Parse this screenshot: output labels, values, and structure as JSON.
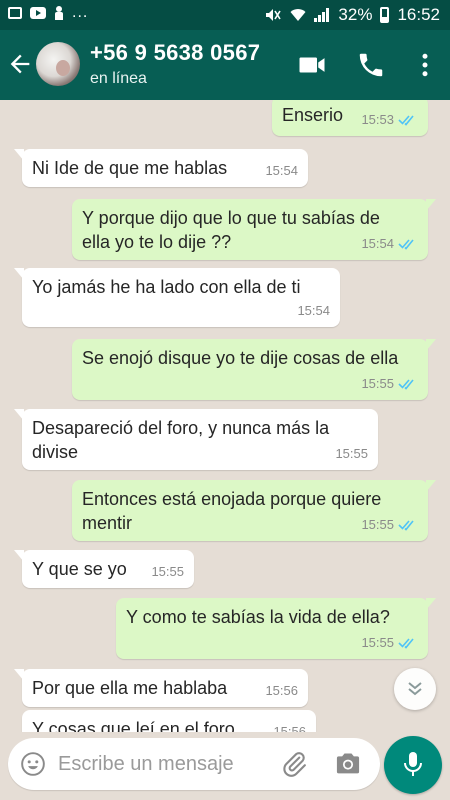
{
  "status_bar": {
    "more": "...",
    "battery": "32%",
    "time": "16:52"
  },
  "header": {
    "contact_name": "+56 9 5638 0567",
    "contact_status": "en línea",
    "colors": {
      "bar": "#075e54",
      "status_bar": "#054d44"
    }
  },
  "messages": [
    {
      "direction": "out",
      "text": "Enserio",
      "time": "15:53",
      "read": true
    },
    {
      "direction": "in",
      "text": "Ni Ide de que me hablas",
      "time": "15:54"
    },
    {
      "direction": "out",
      "text": "Y porque dijo que lo que tu sabías de ella yo te lo dije ??",
      "time": "15:54",
      "read": true
    },
    {
      "direction": "in",
      "text": "Yo jamás he ha lado con ella de ti",
      "time": "15:54"
    },
    {
      "direction": "out",
      "text": "Se enojó disque yo te dije cosas de ella",
      "time": "15:55",
      "read": true
    },
    {
      "direction": "in",
      "text": "Desapareció del foro, y nunca más la divise",
      "time": "15:55"
    },
    {
      "direction": "out",
      "text": "Entonces está enojada porque quiere mentir",
      "time": "15:55",
      "read": true
    },
    {
      "direction": "in",
      "text": "Y que se yo",
      "time": "15:55"
    },
    {
      "direction": "out",
      "text": "Y como te sabías la vida de ella?",
      "time": "15:55",
      "read": true
    },
    {
      "direction": "in",
      "text": "Por que ella me hablaba",
      "time": "15:56"
    },
    {
      "direction": "in",
      "text": "Y cosas que leí en el foro",
      "time": "15:56"
    }
  ],
  "composer": {
    "placeholder": "Escribe un mensaje"
  },
  "icons": {
    "back": "arrow-back-icon",
    "video": "video-call-icon",
    "call": "phone-icon",
    "menu": "more-vert-icon",
    "emoji": "emoji-icon",
    "attach": "paperclip-icon",
    "camera": "camera-icon",
    "mic": "microphone-icon",
    "scroll": "chevron-double-down-icon"
  },
  "colors": {
    "outgoing_bubble": "#dcf8c6",
    "incoming_bubble": "#ffffff",
    "read_ticks": "#4fc3f7",
    "mic_button": "#00897b"
  }
}
